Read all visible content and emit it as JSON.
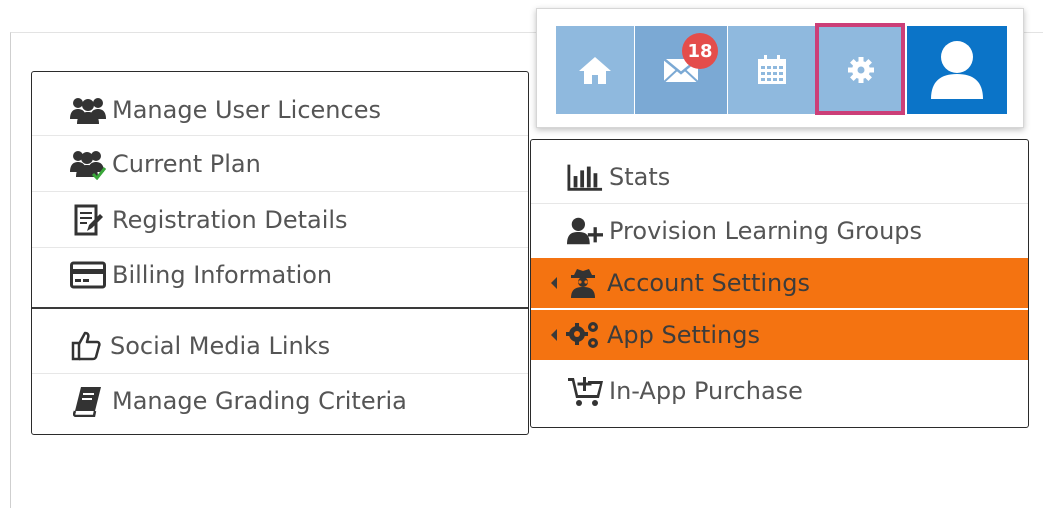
{
  "toolbar": {
    "mail_badge_count": "18",
    "buttons": [
      "home-icon",
      "envelope-icon",
      "calendar-icon",
      "gear-icon",
      "user-icon"
    ],
    "colors": {
      "button": "#8fb9de",
      "mail_button": "#7ba9d4",
      "user_button": "#0b74c8",
      "badge": "#e44d4b",
      "highlight": "#cc3f78"
    }
  },
  "left_menu": {
    "items": [
      {
        "label": "Manage User Licences",
        "icon": "users-icon"
      },
      {
        "label": "Current Plan",
        "icon": "users-check-icon"
      },
      {
        "label": "Registration Details",
        "icon": "edit-document-icon"
      },
      {
        "label": "Billing Information",
        "icon": "credit-card-icon"
      },
      {
        "label": "Social Media Links",
        "icon": "thumbs-up-icon"
      },
      {
        "label": "Manage Grading Criteria",
        "icon": "book-icon"
      }
    ]
  },
  "right_menu": {
    "active_color": "#f47311",
    "items": [
      {
        "label": "Stats",
        "icon": "bar-chart-icon",
        "active": false
      },
      {
        "label": "Provision Learning Groups",
        "icon": "user-plus-icon",
        "active": false
      },
      {
        "label": "Account Settings",
        "icon": "user-secret-icon",
        "active": true
      },
      {
        "label": "App Settings",
        "icon": "cogs-icon",
        "active": true
      },
      {
        "label": "In-App Purchase",
        "icon": "cart-plus-icon",
        "active": false
      }
    ]
  }
}
